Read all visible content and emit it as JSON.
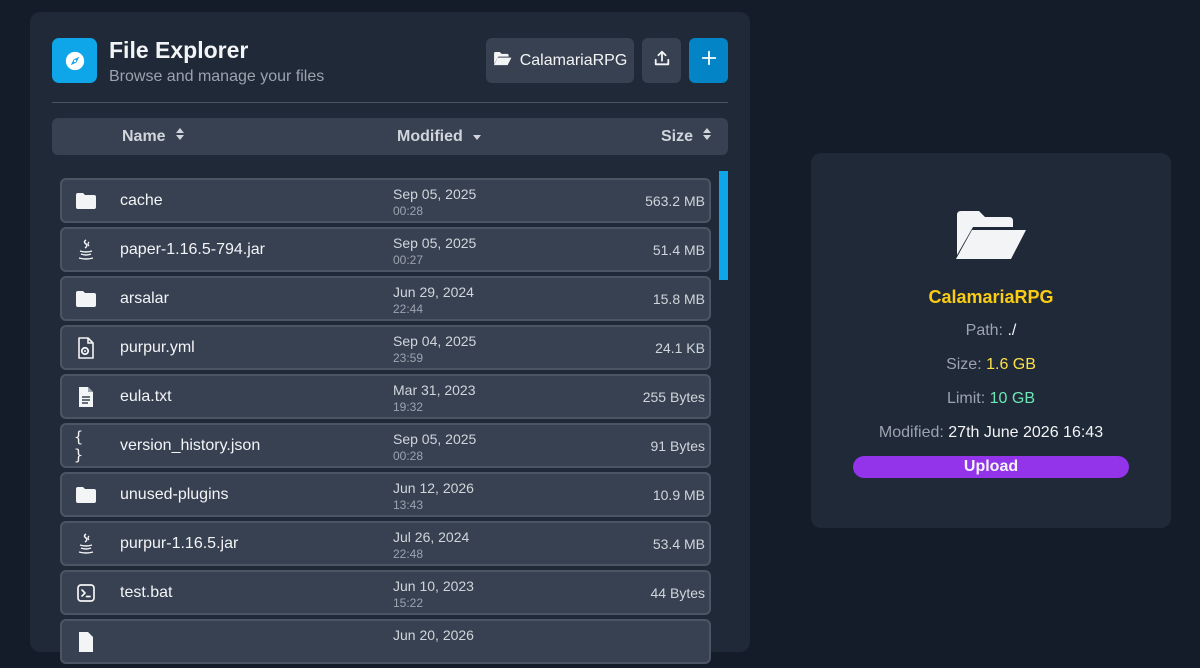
{
  "header": {
    "title": "File Explorer",
    "subtitle": "Browse and manage your files",
    "current_dir": "CalamariaRPG",
    "logo_icon": "compass-icon",
    "accent": "#0ea5e9"
  },
  "table": {
    "columns": {
      "name": "Name",
      "modified": "Modified",
      "size": "Size"
    },
    "rows": [
      {
        "icon": "folder-icon",
        "name": "cache",
        "date": "Sep 05, 2025",
        "time": "00:28",
        "size": "563.2 MB"
      },
      {
        "icon": "java-icon",
        "name": "paper-1.16.5-794.jar",
        "date": "Sep 05, 2025",
        "time": "00:27",
        "size": "51.4 MB"
      },
      {
        "icon": "folder-icon",
        "name": "arsalar",
        "date": "Jun 29, 2024",
        "time": "22:44",
        "size": "15.8 MB"
      },
      {
        "icon": "config-file-icon",
        "name": "purpur.yml",
        "date": "Sep 04, 2025",
        "time": "23:59",
        "size": "24.1 KB"
      },
      {
        "icon": "text-file-icon",
        "name": "eula.txt",
        "date": "Mar 31, 2023",
        "time": "19:32",
        "size": "255 Bytes"
      },
      {
        "icon": "json-icon",
        "name": "version_history.json",
        "date": "Sep 05, 2025",
        "time": "00:28",
        "size": "91 Bytes"
      },
      {
        "icon": "folder-icon",
        "name": "unused-plugins",
        "date": "Jun 12, 2026",
        "time": "13:43",
        "size": "10.9 MB"
      },
      {
        "icon": "java-icon",
        "name": "purpur-1.16.5.jar",
        "date": "Jul 26, 2024",
        "time": "22:48",
        "size": "53.4 MB"
      },
      {
        "icon": "terminal-icon",
        "name": "test.bat",
        "date": "Jun 10, 2023",
        "time": "15:22",
        "size": "44 Bytes"
      },
      {
        "icon": "file-icon",
        "name": "",
        "date": "Jun 20, 2026",
        "time": "",
        "size": ""
      }
    ]
  },
  "info": {
    "name": "CalamariaRPG",
    "path_label": "Path:",
    "path_value": "./",
    "size_label": "Size:",
    "size_value": "1.6 GB",
    "limit_label": "Limit:",
    "limit_value": "10 GB",
    "modified_label": "Modified:",
    "modified_value": "27th June 2026 16:43",
    "upload_label": "Upload",
    "name_color": "#facc15",
    "upload_color": "#9333ea"
  }
}
